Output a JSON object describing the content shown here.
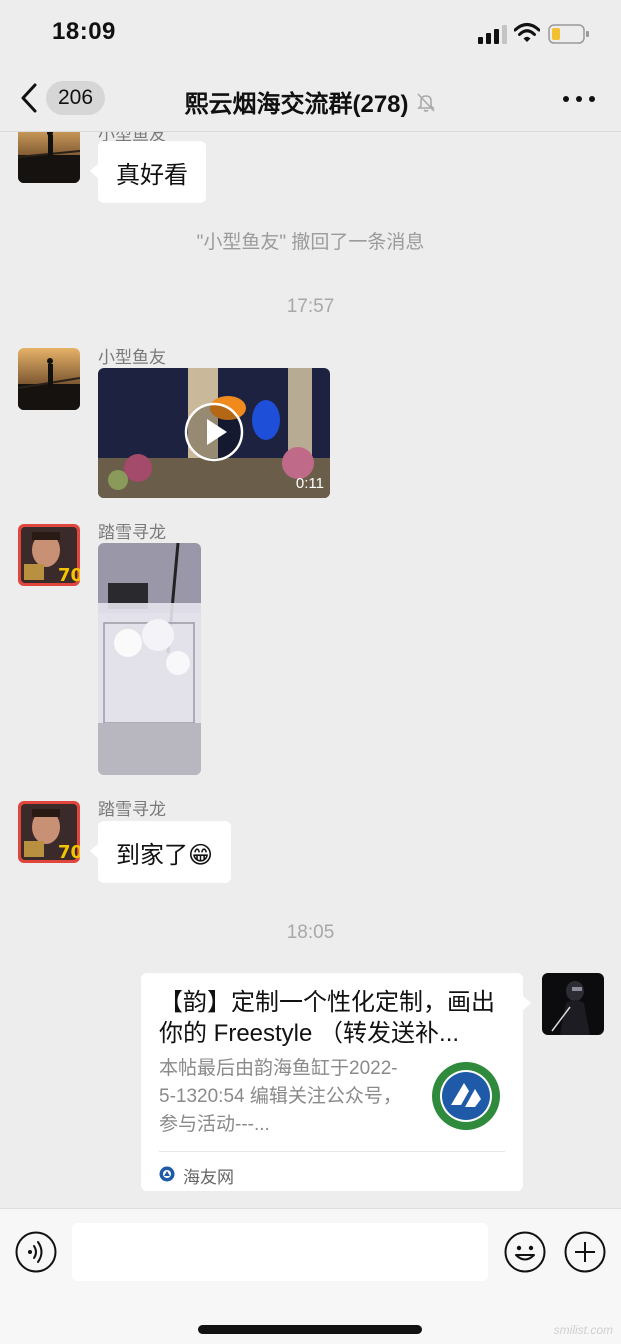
{
  "status_bar": {
    "time": "18:09"
  },
  "nav": {
    "unread_count": "206",
    "title": "熙云烟海交流群(278)",
    "icons": [
      "chevron-left-icon",
      "bell-muted-icon",
      "more-icon"
    ]
  },
  "messages": {
    "first": {
      "name_partial": "小型鱼友",
      "text": "真好看"
    },
    "recall_notice": "\"小型鱼友\" 撤回了一条消息",
    "time_1757": "17:57",
    "video_msg": {
      "sender": "小型鱼友",
      "duration": "0:11"
    },
    "photo_msg": {
      "sender": "踏雪寻龙"
    },
    "text_msg": {
      "sender": "踏雪寻龙",
      "text": "到家了😁"
    },
    "time_1805": "18:05",
    "link_card": {
      "title": "【韵】定制一个性化定制，画出你的 Freestyle （转发送补...",
      "description": "本帖最后由韵海鱼缸于2022-5-1320:54 编辑关注公众号，参与活动---...",
      "source": "海友网"
    }
  },
  "input_bar": {
    "placeholder": "",
    "icons": [
      "voice-icon",
      "emoji-icon",
      "plus-icon"
    ]
  },
  "watermark": "smilist.com",
  "colors": {
    "background": "#ededed",
    "bubble": "#ffffff",
    "meta_text": "#9b9b9b",
    "logo_green": "#2f8a3d",
    "logo_blue": "#1f5aa8"
  }
}
